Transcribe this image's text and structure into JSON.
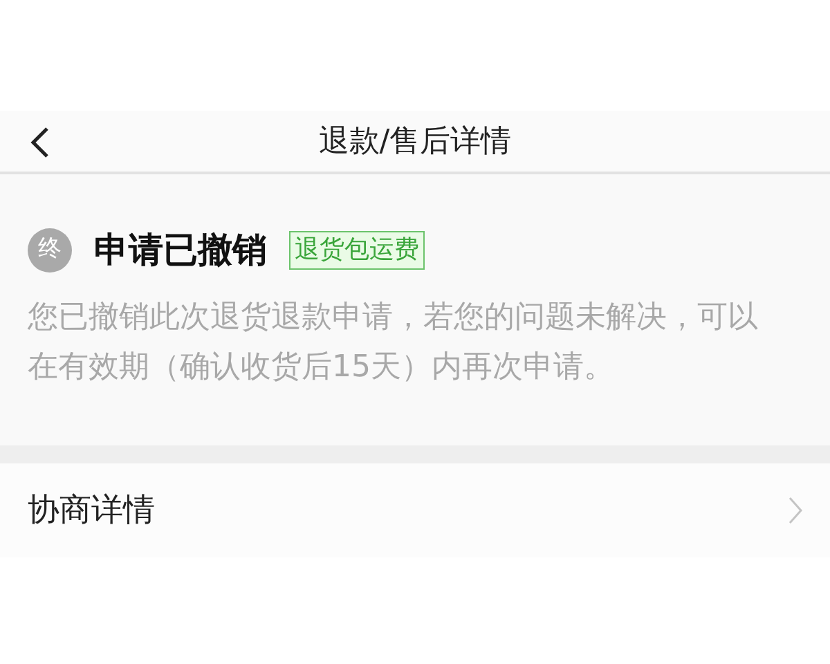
{
  "header": {
    "title": "退款/售后详情"
  },
  "status": {
    "badge": "终",
    "title": "申请已撤销",
    "tag": "退货包运费",
    "description": "您已撤销此次退货退款申请，若您的问题未解决，可以在有效期（确认收货后15天）内再次申请。"
  },
  "rows": [
    {
      "label": "协商详情"
    }
  ]
}
